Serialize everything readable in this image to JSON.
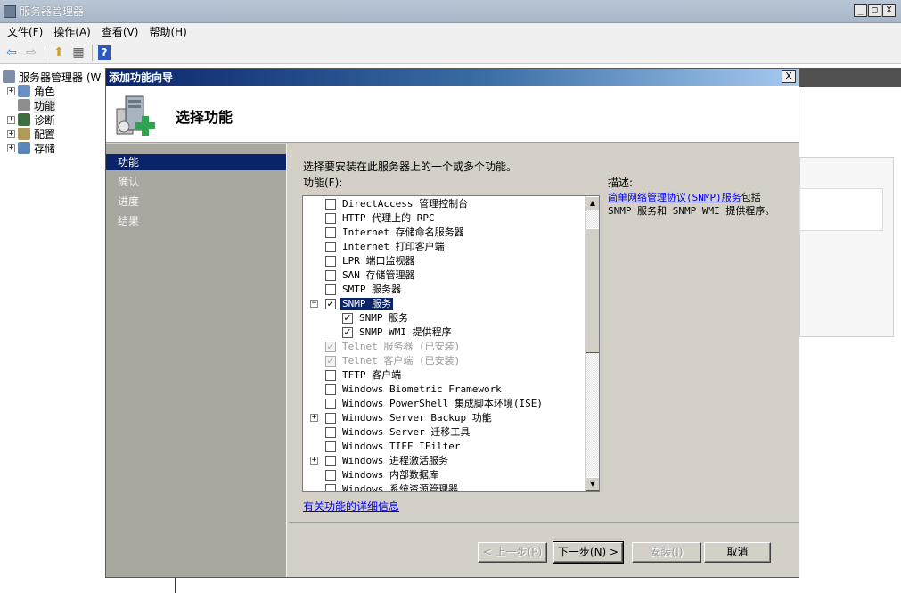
{
  "app": {
    "title": "服务器管理器",
    "window_buttons": [
      "_",
      "□",
      "X"
    ]
  },
  "menu": [
    "文件(F)",
    "操作(A)",
    "查看(V)",
    "帮助(H)"
  ],
  "toolbar": {
    "back": "⇦",
    "forward": "⇨",
    "up": "⬆",
    "view": "▦",
    "help": "?"
  },
  "tree": {
    "root": "服务器管理器 (W",
    "items": [
      {
        "label": "角色",
        "expander": "+"
      },
      {
        "label": "功能",
        "expander": ""
      },
      {
        "label": "诊断",
        "expander": "+"
      },
      {
        "label": "配置",
        "expander": "+"
      },
      {
        "label": "存储",
        "expander": "+"
      }
    ]
  },
  "dialog": {
    "title": "添加功能向导",
    "close": "X",
    "header_title": "选择功能",
    "steps": [
      "功能",
      "确认",
      "进度",
      "结果"
    ],
    "instruction": "选择要安装在此服务器上的一个或多个功能。",
    "features_label": "功能(F):",
    "description_label": "描述:",
    "description_link": "简单网络管理协议(SNMP)服务",
    "description_rest": "包括 SNMP 服务和 SNMP WMI 提供程序。",
    "more_info_link": "有关功能的详细信息",
    "features": [
      {
        "label": "DirectAccess 管理控制台",
        "checked": false
      },
      {
        "label": "HTTP 代理上的 RPC",
        "checked": false
      },
      {
        "label": "Internet 存储命名服务器",
        "checked": false
      },
      {
        "label": "Internet 打印客户端",
        "checked": false
      },
      {
        "label": "LPR 端口监视器",
        "checked": false
      },
      {
        "label": "SAN 存储管理器",
        "checked": false
      },
      {
        "label": "SMTP 服务器",
        "checked": false
      },
      {
        "label": "SNMP 服务",
        "checked": true,
        "expander": "−",
        "selected": true
      },
      {
        "label": "SNMP 服务",
        "checked": true,
        "child": true
      },
      {
        "label": "SNMP WMI 提供程序",
        "checked": true,
        "child": true
      },
      {
        "label": "Telnet 服务器  (已安装)",
        "checked": true,
        "disabled": true
      },
      {
        "label": "Telnet 客户端  (已安装)",
        "checked": true,
        "disabled": true
      },
      {
        "label": "TFTP 客户端",
        "checked": false
      },
      {
        "label": "Windows Biometric Framework",
        "checked": false
      },
      {
        "label": "Windows PowerShell 集成脚本环境(ISE)",
        "checked": false
      },
      {
        "label": "Windows Server Backup 功能",
        "checked": false,
        "expander": "+"
      },
      {
        "label": "Windows Server 迁移工具",
        "checked": false
      },
      {
        "label": "Windows TIFF IFilter",
        "checked": false
      },
      {
        "label": "Windows 进程激活服务",
        "checked": false,
        "expander": "+"
      },
      {
        "label": "Windows 内部数据库",
        "checked": false
      },
      {
        "label": "Windows 系统资源管理器",
        "checked": false
      }
    ],
    "buttons": {
      "prev": "< 上一步(P)",
      "next": "下一步(N) >",
      "install": "安装(I)",
      "cancel": "取消"
    }
  }
}
